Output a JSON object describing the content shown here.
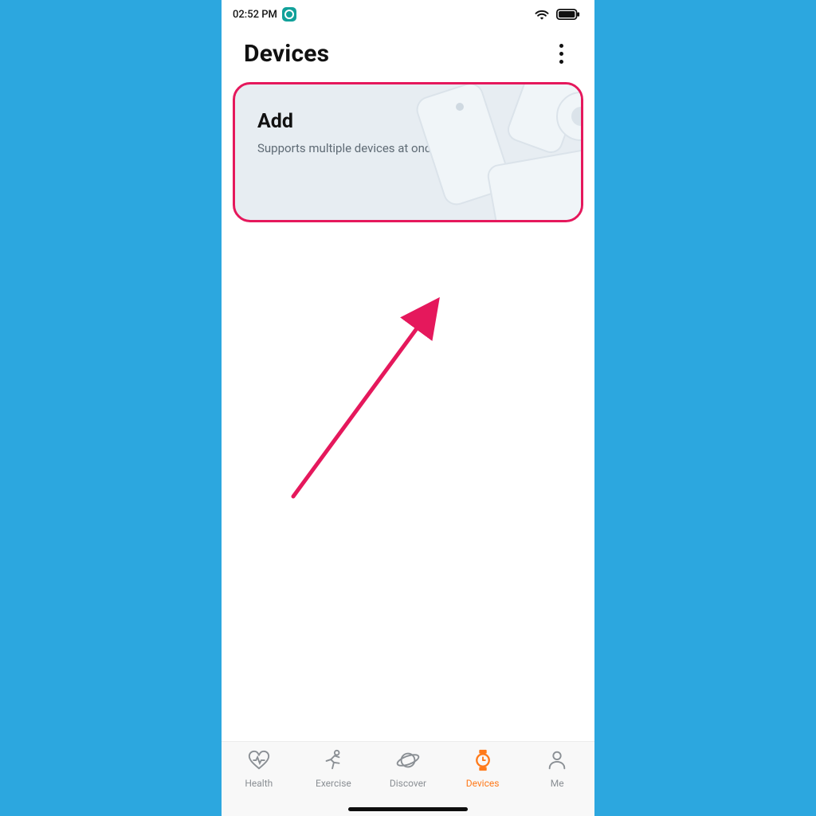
{
  "status": {
    "time": "02:52 PM"
  },
  "header": {
    "title": "Devices"
  },
  "card": {
    "title": "Add",
    "subtitle": "Supports multiple devices at once."
  },
  "nav": {
    "items": [
      {
        "label": "Health"
      },
      {
        "label": "Exercise"
      },
      {
        "label": "Discover"
      },
      {
        "label": "Devices"
      },
      {
        "label": "Me"
      }
    ],
    "active_index": 3
  },
  "annotation": {
    "highlight_color": "#e5185c"
  }
}
